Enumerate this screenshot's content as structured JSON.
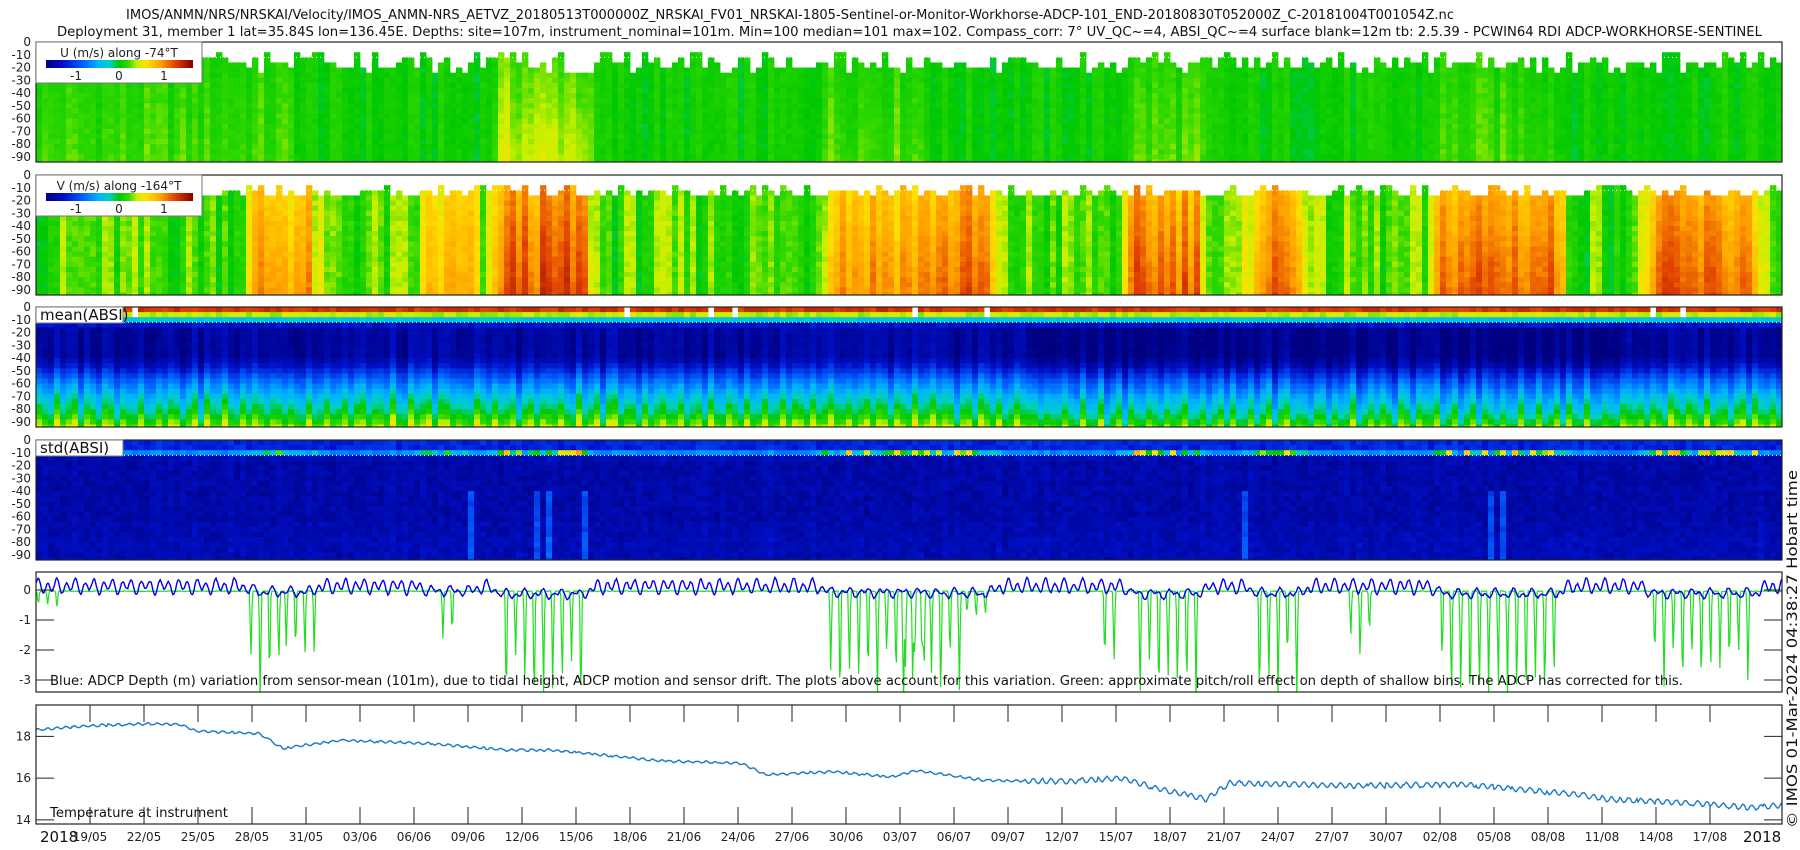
{
  "header": {
    "title_line1": "IMOS/ANMN/NRS/NRSKAI/Velocity/IMOS_ANMN-NRS_AETVZ_20180513T000000Z_NRSKAI_FV01_NRSKAI-1805-Sentinel-or-Monitor-Workhorse-ADCP-101_END-20180830T052000Z_C-20181004T001054Z.nc",
    "title_line2": "Deployment 31, member 1 lat=35.84S lon=136.45E. Depths: site=107m, instrument_nominal=101m. Min=100 median=101 max=102. Compass_corr: 7° UV_QC~=4, ABSI_QC~=4 surface blank=12m tb: 2.5.39 - PCWIN64 RDI ADCP-WORKHORSE-SENTINEL"
  },
  "credit": "© IMOS 01-Mar-2024 04:38:27 Hobart time",
  "chart_data": {
    "type": "heatmap",
    "x_axis": {
      "start_date": "2018-05-16",
      "span_days": 97,
      "first_tick_day": 3,
      "tick_step_days": 3,
      "tick_labels": [
        "19/05",
        "22/05",
        "25/05",
        "28/05",
        "31/05",
        "03/06",
        "06/06",
        "09/06",
        "12/06",
        "15/06",
        "18/06",
        "21/06",
        "24/06",
        "27/06",
        "30/06",
        "03/07",
        "06/07",
        "09/07",
        "12/07",
        "15/07",
        "18/07",
        "21/07",
        "24/07",
        "27/07",
        "30/07",
        "02/08",
        "05/08",
        "08/08",
        "11/08",
        "14/08",
        "17/08"
      ],
      "year_label_left": "2018",
      "year_label_right": "2018"
    },
    "colormap": [
      [
        0,
        "#000080"
      ],
      [
        0.12,
        "#0010c8"
      ],
      [
        0.25,
        "#0060ff"
      ],
      [
        0.36,
        "#00b4ff"
      ],
      [
        0.43,
        "#00d0c0"
      ],
      [
        0.5,
        "#00c800"
      ],
      [
        0.56,
        "#30d800"
      ],
      [
        0.62,
        "#c8f000"
      ],
      [
        0.68,
        "#ffe000"
      ],
      [
        0.78,
        "#ffa000"
      ],
      [
        0.88,
        "#e04000"
      ],
      [
        1,
        "#800000"
      ]
    ],
    "depth_bins": [
      0,
      4,
      8,
      12,
      16,
      20,
      24,
      28,
      32,
      36,
      40,
      44,
      48,
      52,
      56,
      60,
      64,
      68,
      72,
      76,
      80,
      84,
      88,
      92,
      96
    ],
    "surface_blank_m": 12,
    "heatmaps": [
      {
        "id": "u",
        "label": "U (m/s) along -74°T",
        "units": "m/s",
        "ylim": [
          -94,
          0
        ],
        "yticks": [
          0,
          -10,
          -20,
          -30,
          -40,
          -50,
          -60,
          -70,
          -80,
          -90
        ],
        "ytick_labels": [
          "0",
          "-10",
          "-20",
          "-30",
          "-40",
          "-50",
          "-60",
          "-70",
          "-80",
          "-90"
        ],
        "clim": [
          -1.7,
          1.7
        ],
        "cbar_tick_values": [
          -1,
          0,
          1
        ],
        "cbar_tick_labels": [
          "-1",
          "0",
          "1"
        ],
        "background_value": 0.05,
        "events": [
          [
            0,
            14,
            0.12
          ],
          [
            26,
            30.3,
            0.3
          ],
          [
            44,
            49,
            0.15
          ],
          [
            61,
            64.4,
            0.15
          ],
          [
            78,
            84,
            0.12
          ]
        ]
      },
      {
        "id": "v",
        "label": "V (m/s) along -164°T",
        "units": "m/s",
        "ylim": [
          -94,
          0
        ],
        "yticks": [
          0,
          -10,
          -20,
          -30,
          -40,
          -50,
          -60,
          -70,
          -80,
          -90
        ],
        "ytick_labels": [
          "0",
          "-10",
          "-20",
          "-30",
          "-40",
          "-50",
          "-60",
          "-70",
          "-80",
          "-90"
        ],
        "clim": [
          -1.7,
          1.7
        ],
        "cbar_tick_values": [
          -1,
          0,
          1
        ],
        "cbar_tick_labels": [
          "-1",
          "0",
          "1"
        ],
        "background_value": 0.2,
        "events": [
          [
            12.4,
            15,
            0.7
          ],
          [
            22,
            24,
            0.55
          ],
          [
            26,
            30.3,
            0.95
          ],
          [
            44.3,
            49.4,
            0.75
          ],
          [
            49.9,
            52.7,
            0.85
          ],
          [
            61.2,
            64.4,
            0.9
          ],
          [
            68,
            70,
            0.85
          ],
          [
            78.3,
            84.3,
            0.9
          ],
          [
            90,
            95.3,
            0.85
          ]
        ]
      },
      {
        "id": "absi_mean",
        "label": "mean(ABSI)",
        "ylim": [
          -94,
          0
        ],
        "yticks": [
          0,
          -10,
          -20,
          -30,
          -40,
          -50,
          -60,
          -70,
          -80,
          -90
        ],
        "ytick_labels": [
          "0",
          "-10",
          "-20",
          "-30",
          "-40",
          "-50",
          "-60",
          "-70",
          "-80",
          "-90"
        ],
        "normalized_profile": [
          0.9,
          0.62,
          0.4,
          0.12,
          0.06,
          0.05,
          0.05,
          0.05,
          0.05,
          0.05,
          0.08,
          0.12,
          0.17,
          0.22,
          0.27,
          0.31,
          0.35,
          0.39,
          0.42,
          0.45,
          0.48,
          0.52,
          0.56,
          0.6
        ]
      },
      {
        "id": "absi_std",
        "label": "std(ABSI)",
        "ylim": [
          -94,
          0
        ],
        "yticks": [
          0,
          -10,
          -20,
          -30,
          -40,
          -50,
          -60,
          -70,
          -80,
          -90
        ],
        "ytick_labels": [
          "0",
          "-10",
          "-20",
          "-30",
          "-40",
          "-50",
          "-60",
          "-70",
          "-80",
          "-90"
        ],
        "normalized_profile": [
          0.15,
          0.15,
          0.3,
          0.08,
          0.06,
          0.06,
          0.06,
          0.06,
          0.06,
          0.06,
          0.06,
          0.06,
          0.06,
          0.06,
          0.06,
          0.06,
          0.07,
          0.07,
          0.07,
          0.08,
          0.08,
          0.08,
          0.08,
          0.08
        ]
      }
    ],
    "depth_variation": {
      "type": "line",
      "ylim": [
        -3.4,
        0.6
      ],
      "yticks": [
        0,
        -1,
        -2,
        -3
      ],
      "ytick_labels": [
        "0",
        "-1",
        "-2",
        "-3"
      ],
      "caption": "Blue: ADCP Depth (m) variation from sensor-mean (101m), due to tidal height, ADCP motion and sensor drift. The plots above account for this variation. Green: approximate pitch/roll effect on depth of shallow bins. The ADCP has corrected for this.",
      "series": [
        {
          "name": "ADCP depth variation",
          "color": "#0000ee",
          "baseline": 0.12,
          "tidal_amplitude": 0.18
        },
        {
          "name": "pitch/roll effect",
          "color": "#22dd22",
          "events": [
            [
              0,
              1.3,
              0.7
            ],
            [
              12.1,
              13.7,
              3.4
            ],
            [
              13.7,
              15.5,
              2
            ],
            [
              22.4,
              23,
              1.5
            ],
            [
              26,
              30.3,
              3.4
            ],
            [
              44.3,
              49.4,
              3.4
            ],
            [
              48,
              51.4,
              3.4
            ],
            [
              51.8,
              52.7,
              1
            ],
            [
              59.2,
              59.8,
              2.5
            ],
            [
              61.2,
              64.4,
              3.4
            ],
            [
              68,
              70,
              3.4
            ],
            [
              73.2,
              74.2,
              2
            ],
            [
              78.3,
              84.3,
              3.4
            ],
            [
              90,
              95.3,
              3
            ]
          ]
        }
      ]
    },
    "temperature": {
      "type": "line",
      "label": "Temperature at instrument",
      "color": "#1a78c8",
      "ylim": [
        13.8,
        19.5
      ],
      "yticks": [
        14,
        16,
        18
      ],
      "ytick_labels": [
        "14",
        "16",
        "18"
      ],
      "points_day_degC": [
        [
          0,
          18.31
        ],
        [
          2.9,
          18.5
        ],
        [
          6,
          18.6
        ],
        [
          8,
          18.57
        ],
        [
          8.9,
          18.25
        ],
        [
          12.4,
          18.13
        ],
        [
          13.7,
          17.42
        ],
        [
          16.9,
          17.81
        ],
        [
          22,
          17.65
        ],
        [
          26.1,
          17.34
        ],
        [
          28.7,
          17.34
        ],
        [
          31.6,
          17.1
        ],
        [
          34.7,
          16.82
        ],
        [
          39.2,
          16.71
        ],
        [
          40.5,
          16.16
        ],
        [
          44.3,
          16.31
        ],
        [
          47.5,
          16.05
        ],
        [
          48.9,
          16.36
        ],
        [
          52.7,
          15.89
        ],
        [
          57.4,
          15.84
        ],
        [
          60.3,
          16.0
        ],
        [
          62.5,
          15.45
        ],
        [
          65,
          15.0
        ],
        [
          66.3,
          15.76
        ],
        [
          73.2,
          15.64
        ],
        [
          79.5,
          15.69
        ],
        [
          85.8,
          15.2
        ],
        [
          87.4,
          14.98
        ],
        [
          92.1,
          14.8
        ],
        [
          95.3,
          14.58
        ],
        [
          97,
          14.69
        ]
      ]
    }
  }
}
